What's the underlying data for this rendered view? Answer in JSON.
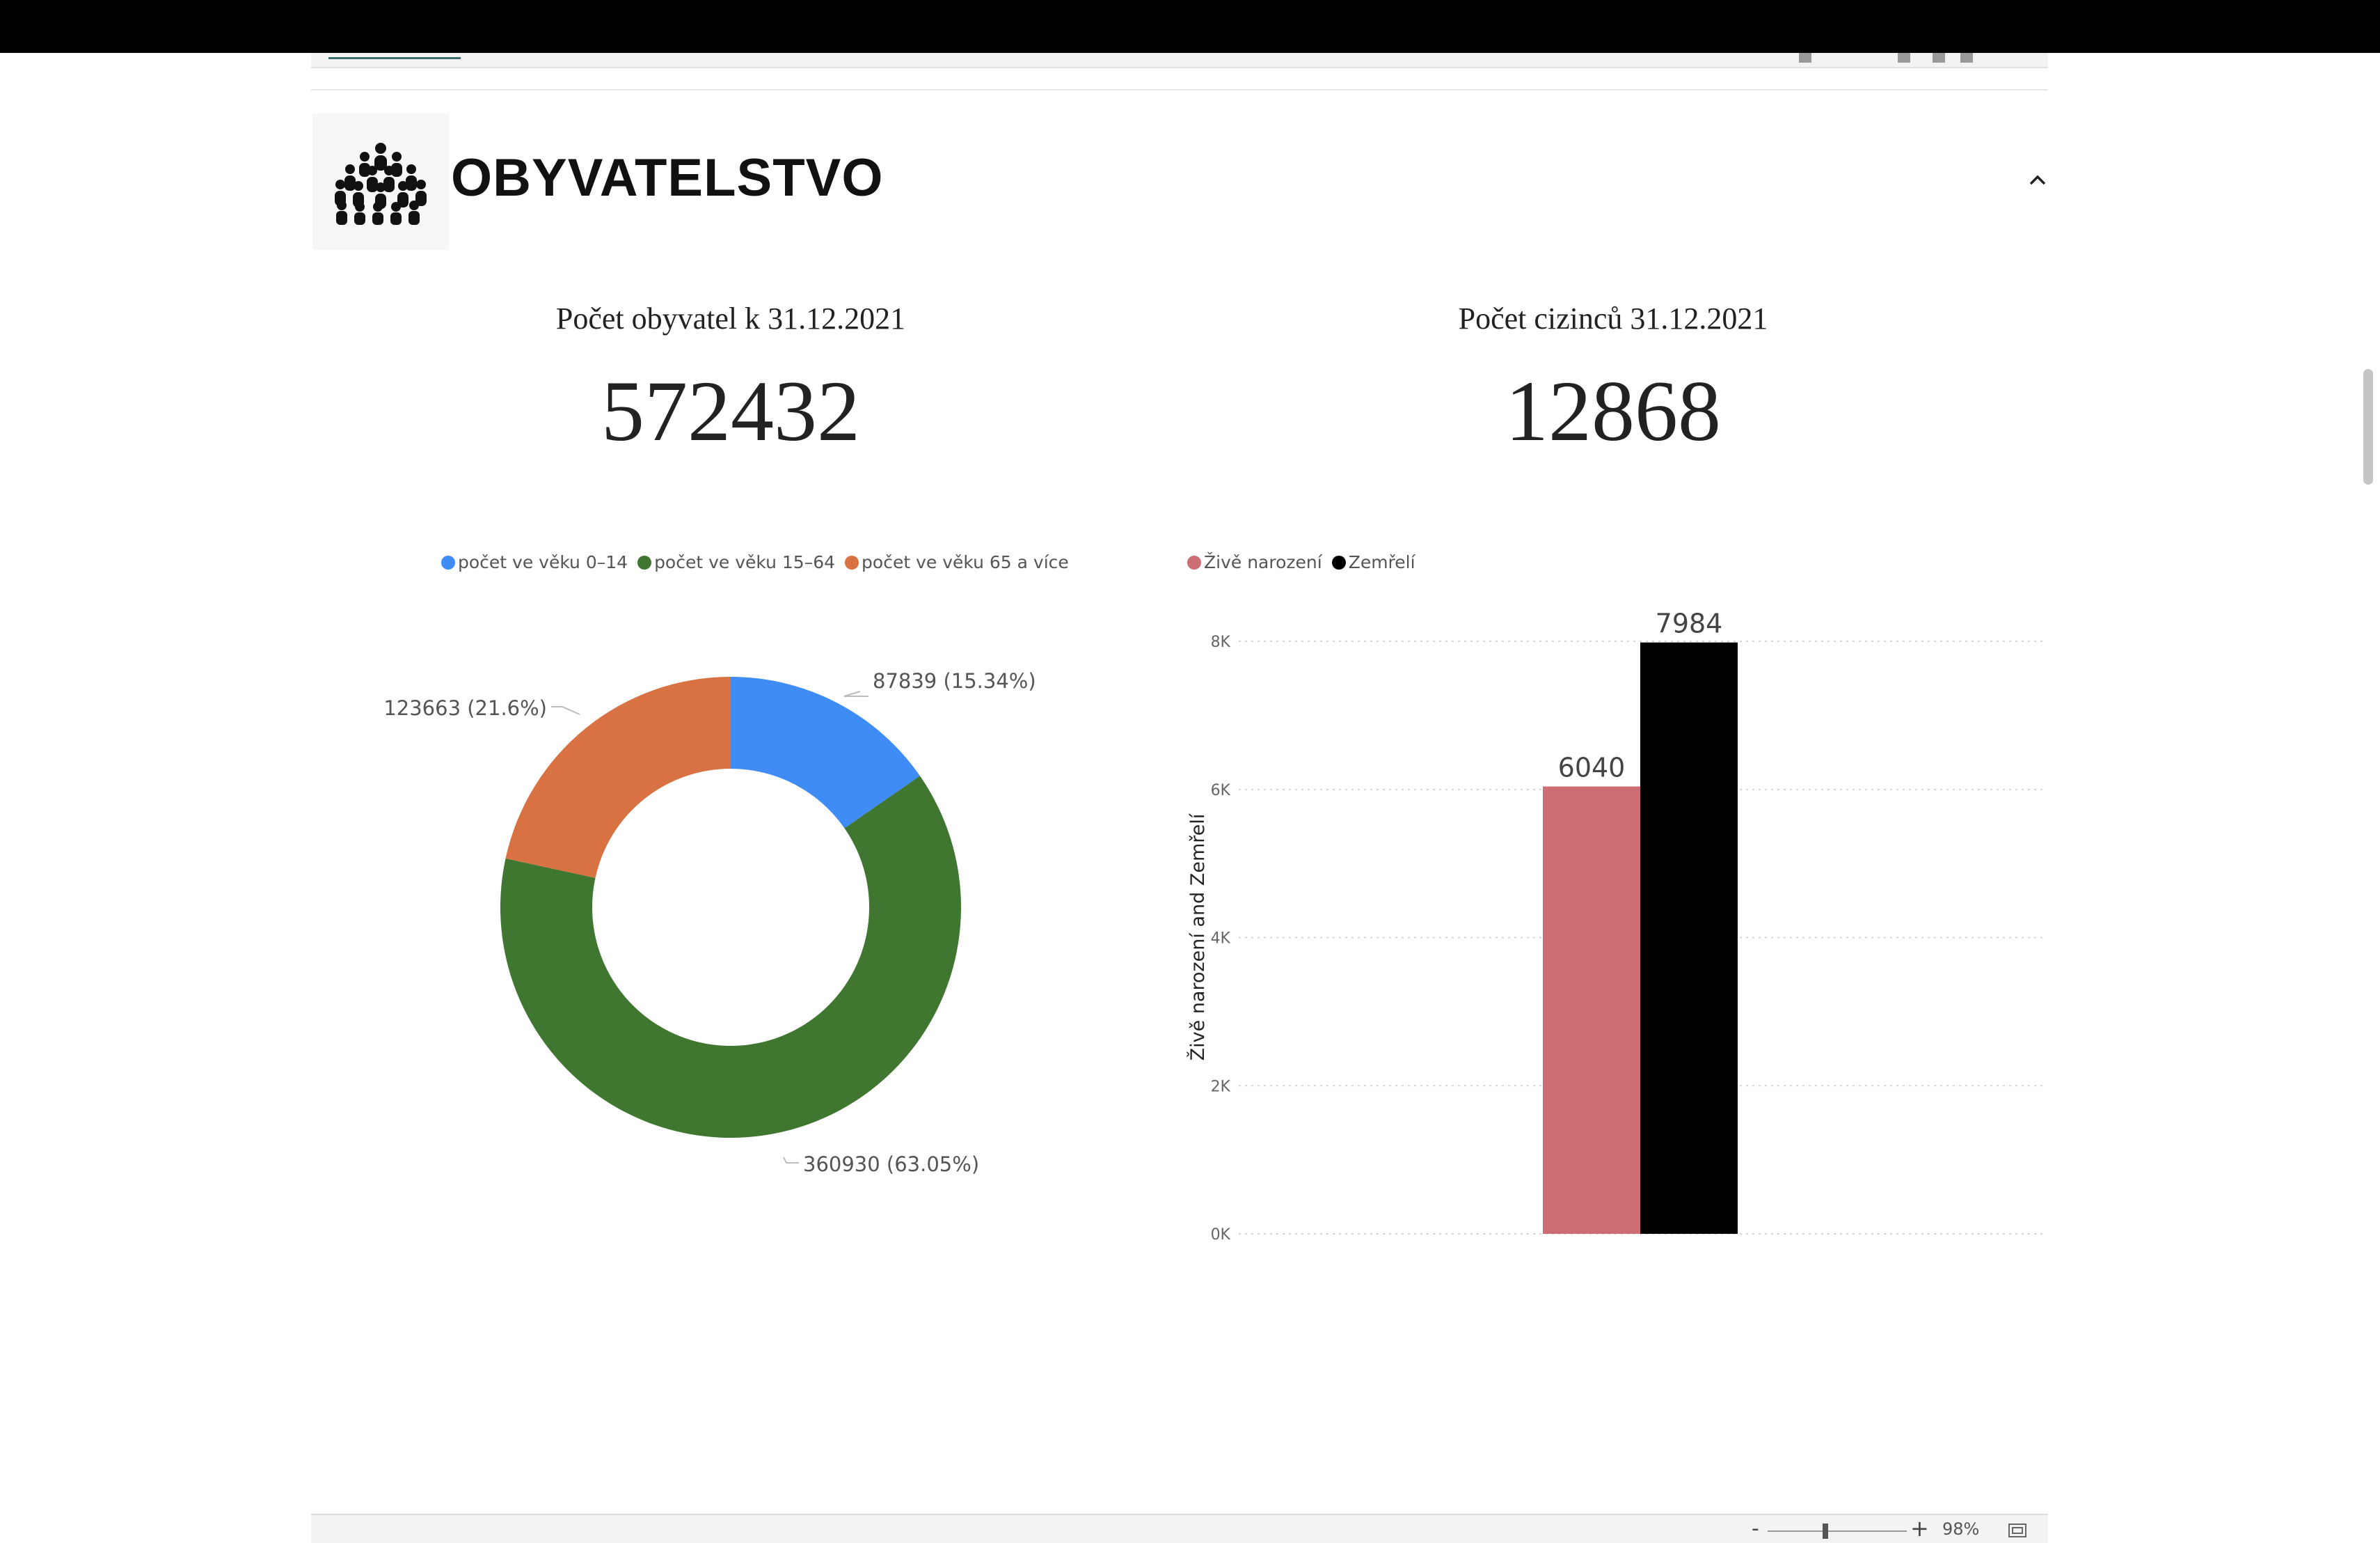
{
  "section": {
    "title": "OBYVATELSTVO",
    "logo_icon": "people-crowd-icon",
    "collapse_icon": "chevron-up-icon"
  },
  "kpis": [
    {
      "label": "Počet obyvatel k 31.12.2021",
      "value": "572432"
    },
    {
      "label": "Počet cizinců 31.12.2021",
      "value": "12868"
    }
  ],
  "colors": {
    "age_0_14": "#3F8CF7",
    "age_15_64": "#3F7630",
    "age_65_plus": "#D87242",
    "births": "#CF6D75",
    "deaths": "#000000"
  },
  "chart_data": [
    {
      "type": "pie",
      "style": "donut",
      "legend_position": "top",
      "categories": [
        "počet ve věku 0–14",
        "počet ve věku 15–64",
        "počet ve věku 65 a více"
      ],
      "values": [
        87839,
        360930,
        123663
      ],
      "data_labels": [
        "87839 (15.34%)",
        "360930 (63.05%)",
        "123663 (21.6%)"
      ]
    },
    {
      "type": "bar",
      "legend_position": "top-left",
      "categories": [
        ""
      ],
      "series": [
        {
          "name": "Živě narození",
          "values": [
            6040
          ]
        },
        {
          "name": "Zemřelí",
          "values": [
            7984
          ]
        }
      ],
      "ylabel": "Živě narození and Zemřelí",
      "ylim": [
        0,
        8000
      ],
      "yticks": [
        "0K",
        "2K",
        "4K",
        "6K",
        "8K"
      ],
      "ytick_values": [
        0,
        2000,
        4000,
        6000,
        8000
      ],
      "data_labels": [
        "6040",
        "7984"
      ],
      "grid": true
    }
  ],
  "footer": {
    "zoom_minus": "-",
    "zoom_plus": "+",
    "zoom_level": "98%",
    "zoom_level_value": 98,
    "fit_icon": "fit-to-page-icon"
  }
}
